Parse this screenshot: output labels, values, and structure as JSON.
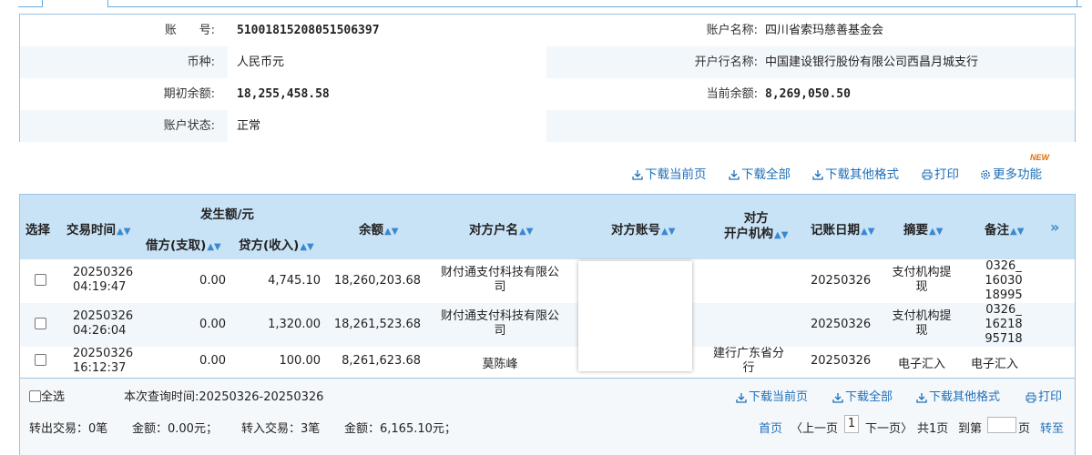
{
  "account": {
    "number_label": "账      号:",
    "number": "51001815208051506397",
    "name_label": "账户名称:",
    "name": "四川省索玛慈善基金会",
    "currency_label": "币种:",
    "currency": "人民币元",
    "bank_label": "开户行名称:",
    "bank": "中国建设银行股份有限公司西昌月城支行",
    "opening_balance_label": "期初余额:",
    "opening_balance": "18,255,458.58",
    "current_balance_label": "当前余额:",
    "current_balance": "8,269,050.50",
    "status_label": "账户状态:",
    "status": "正常"
  },
  "toolbar": {
    "download_page": "下载当前页",
    "download_all": "下载全部",
    "download_other": "下载其他格式",
    "print": "打印",
    "more": "更多功能",
    "new_badge": "NEW"
  },
  "grid": {
    "headers": {
      "select": "选择",
      "time": "交易时间",
      "amount_group": "发生额/元",
      "debit": "借方(支取)",
      "credit": "贷方(收入)",
      "balance": "余额",
      "counterparty_name": "对方户名",
      "counterparty_account": "对方账号",
      "counterparty_bank_1": "对方",
      "counterparty_bank_2": "开户机构",
      "post_date": "记账日期",
      "summary": "摘要",
      "remark": "备注",
      "more": "»"
    },
    "rows": [
      {
        "date": "20250326",
        "time": "04:19:47",
        "debit": "0.00",
        "credit": "4,745.10",
        "balance": "18,260,203.68",
        "cp_name_1": "财付通支付科技有限公",
        "cp_name_2": "司",
        "cp_bank_1": "",
        "cp_bank_2": "",
        "post_date": "20250326",
        "summary_1": "支付机构提",
        "summary_2": "现",
        "remark_1": "0326_",
        "remark_2": "16030",
        "remark_3": "18995"
      },
      {
        "date": "20250326",
        "time": "04:26:04",
        "debit": "0.00",
        "credit": "1,320.00",
        "balance": "18,261,523.68",
        "cp_name_1": "财付通支付科技有限公",
        "cp_name_2": "司",
        "cp_bank_1": "",
        "cp_bank_2": "",
        "post_date": "20250326",
        "summary_1": "支付机构提",
        "summary_2": "现",
        "remark_1": "0326_",
        "remark_2": "16218",
        "remark_3": "95718"
      },
      {
        "date": "20250326",
        "time": "16:12:37",
        "debit": "0.00",
        "credit": "100.00",
        "balance": "8,261,623.68",
        "cp_name_1": "莫陈峰",
        "cp_name_2": "",
        "cp_bank_1": "建行广东省分",
        "cp_bank_2": "行",
        "post_date": "20250326",
        "summary_1": "电子汇入",
        "summary_2": "",
        "remark_1": "电子汇入",
        "remark_2": "",
        "remark_3": ""
      }
    ]
  },
  "footer": {
    "select_all": "全选",
    "query_period": "本次查询时间:20250326-20250326",
    "download_page": "下载当前页",
    "download_all": "下载全部",
    "download_other": "下载其他格式",
    "print": "打印",
    "out_count": "转出交易：0笔",
    "out_amount": "金额：0.00元；",
    "in_count": "转入交易：3笔",
    "in_amount": "金额：6,165.10元；",
    "first_page": "首页",
    "prev_page": "〈上一页",
    "current_page": "1",
    "next_page": "下一页〉",
    "total_pages": "共1页",
    "goto_label": "到第",
    "page_unit": "页",
    "goto_button": "转至"
  },
  "colors": {
    "link": "#1e6fb8",
    "header_bg": "#c8e2f6",
    "border": "#9cc3e3",
    "stripe": "#f2f7fc"
  }
}
